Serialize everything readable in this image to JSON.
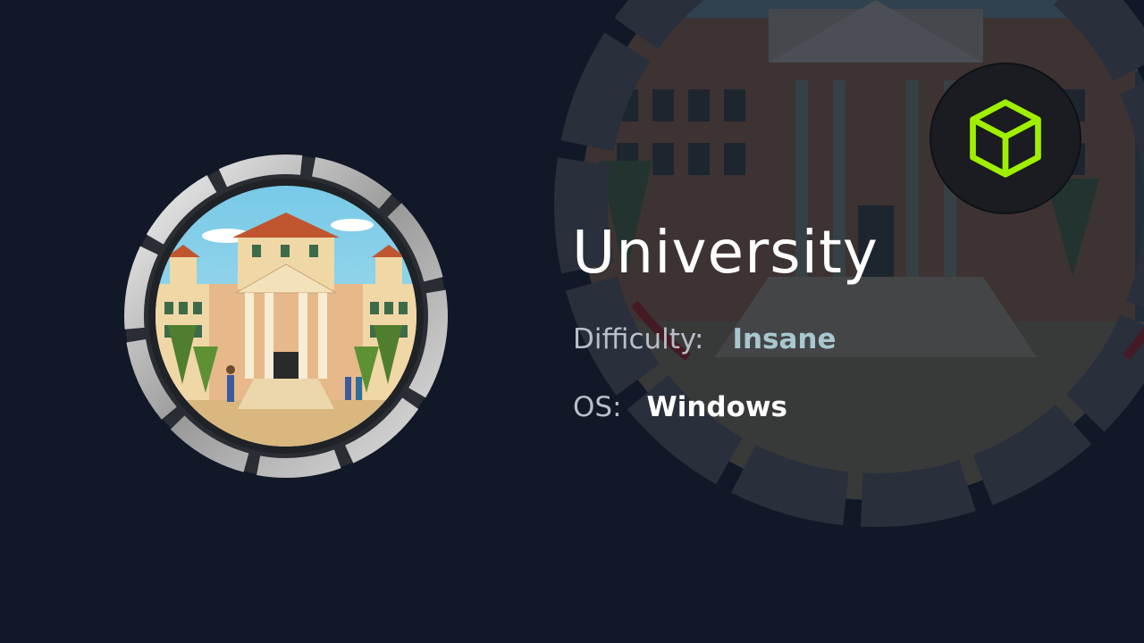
{
  "machine": {
    "name": "University",
    "difficulty_label": "Difficulty:",
    "difficulty": "Insane",
    "os_label": "OS:",
    "os": "Windows"
  },
  "icons": {
    "logo": "cube-icon",
    "badge": "university-building-icon"
  },
  "colors": {
    "background": "#111827",
    "accent_green": "#9fef00",
    "difficulty_color": "#a8c7cf",
    "badge_ring_red": "#e02424"
  }
}
